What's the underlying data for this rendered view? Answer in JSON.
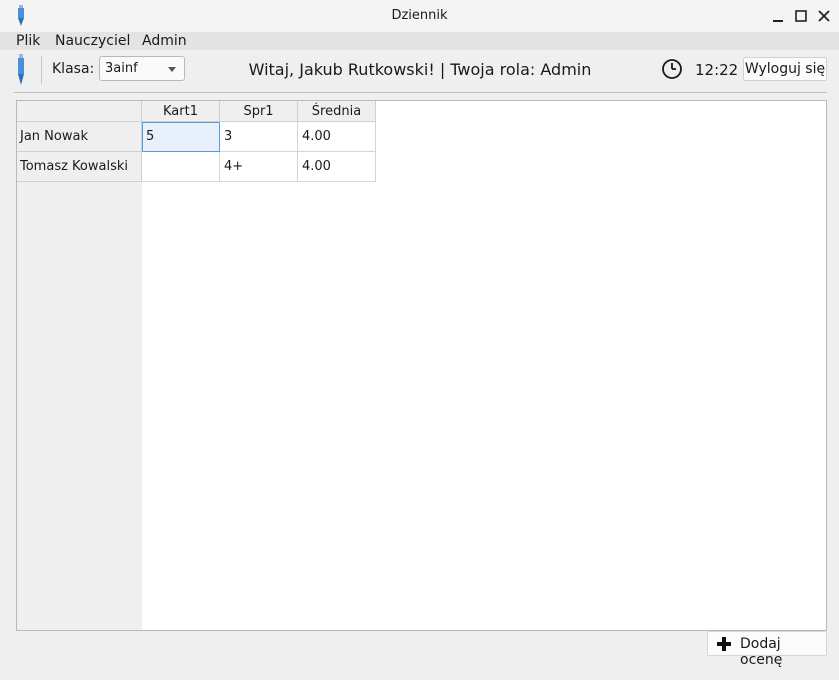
{
  "window": {
    "title": "Dziennik",
    "icon": "pen-icon"
  },
  "menu": {
    "items": [
      "Plik",
      "Nauczyciel",
      "Admin"
    ]
  },
  "toolbar": {
    "icon": "pen-icon",
    "class_label": "Klasa:",
    "class_value": "3ainf",
    "welcome": "Witaj, Jakub Rutkowski! | Twoja rola: Admin",
    "time_icon": "clock-icon",
    "time": "12:22",
    "logout_label": "Wyloguj się"
  },
  "grades": {
    "columns": [
      "Kart1",
      "Spr1",
      "Średnia"
    ],
    "rows": [
      {
        "name": "Jan Nowak",
        "cells": [
          "5",
          "3",
          "4.00"
        ]
      },
      {
        "name": "Tomasz Kowalski",
        "cells": [
          "",
          "4+",
          "4.00"
        ]
      }
    ]
  },
  "actions": {
    "add_grade_label": "Dodaj ocenę",
    "add_icon": "plus-icon"
  },
  "colors": {
    "selection_border": "#5a9ad6",
    "selection_fill": "#e8f1fb",
    "icon_blue": "#4a8fdc"
  }
}
